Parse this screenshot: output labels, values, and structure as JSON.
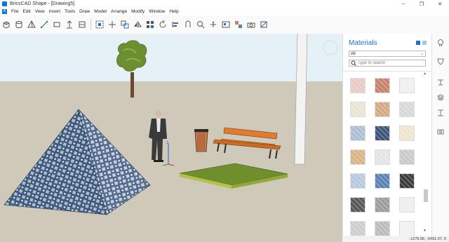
{
  "window": {
    "title": "BricsCAD Shape - [Drawing5]",
    "minimize": "–",
    "maximize": "❐",
    "close": "✕"
  },
  "menu": [
    "File",
    "Edit",
    "View",
    "Insert",
    "Tools",
    "Draw",
    "Model",
    "Arrange",
    "Modify",
    "Window",
    "Help"
  ],
  "toolbar": {
    "icons": [
      "box-icon",
      "cylinder-icon",
      "pyramid-icon",
      "line-icon",
      "rectangle-icon",
      "pushpull-icon",
      "split-icon",
      "group-icon",
      "move-icon",
      "copy-icon",
      "mirror-icon",
      "array-icon",
      "rotate-icon",
      "align-icon",
      "connect-icon",
      "zoom-icon",
      "pan-icon",
      "render-icon",
      "material-icon",
      "camera-icon",
      "section-icon"
    ]
  },
  "materials_panel": {
    "title": "Materials",
    "filter_value": "All",
    "search_placeholder": "Type to search",
    "swatch_colors": [
      "#e9c9c6",
      "#c8806c",
      "#efefef",
      "#ece4d2",
      "#d3a980",
      "#d8d8d8",
      "#aebdd3",
      "#3d5277",
      "#efe4cf",
      "#d9b285",
      "#e4e4e4",
      "#c9c9c9",
      "#b6c8de",
      "#5a81b4",
      "#3a3a3a",
      "#555555",
      "#9b9b9b",
      "#eeeeee",
      "#cccccc",
      "#bbbbbb",
      "#f0f0f0"
    ]
  },
  "side_icons": [
    "lightbulb-icon",
    "theme-icon",
    "layers-icon",
    "stack-icon",
    "profile-icon",
    "camera-icon"
  ],
  "status": {
    "coordinates": "-1276.06, -6491.07, 0"
  },
  "colors": {
    "accent": "#1b73c9",
    "sky": "#e5f1f6",
    "ground": "#cfc9ba"
  }
}
